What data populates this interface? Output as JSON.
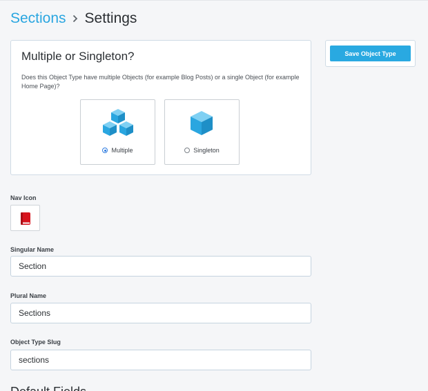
{
  "breadcrumb": {
    "parent": "Sections",
    "separator": "›",
    "current": "Settings"
  },
  "type_card": {
    "title": "Multiple or Singleton?",
    "description": "Does this Object Type have multiple Objects (for example Blog Posts) or a single Object (for example Home Page)?",
    "options": [
      {
        "label": "Multiple",
        "selected": true,
        "icon": "cubes-icon"
      },
      {
        "label": "Singleton",
        "selected": false,
        "icon": "cube-icon"
      }
    ]
  },
  "save_button_label": "Save Object Type",
  "nav_icon": {
    "label": "Nav Icon",
    "icon": "red-book-icon"
  },
  "fields": {
    "singular": {
      "label": "Singular Name",
      "value": "Section"
    },
    "plural": {
      "label": "Plural Name",
      "value": "Sections"
    },
    "slug": {
      "label": "Object Type Slug",
      "value": "sections"
    }
  },
  "next_section_heading": "Default Fields",
  "colors": {
    "accent": "#29a9e1",
    "icon_blue": "#2aa6e0",
    "book_red": "#d7141e"
  }
}
